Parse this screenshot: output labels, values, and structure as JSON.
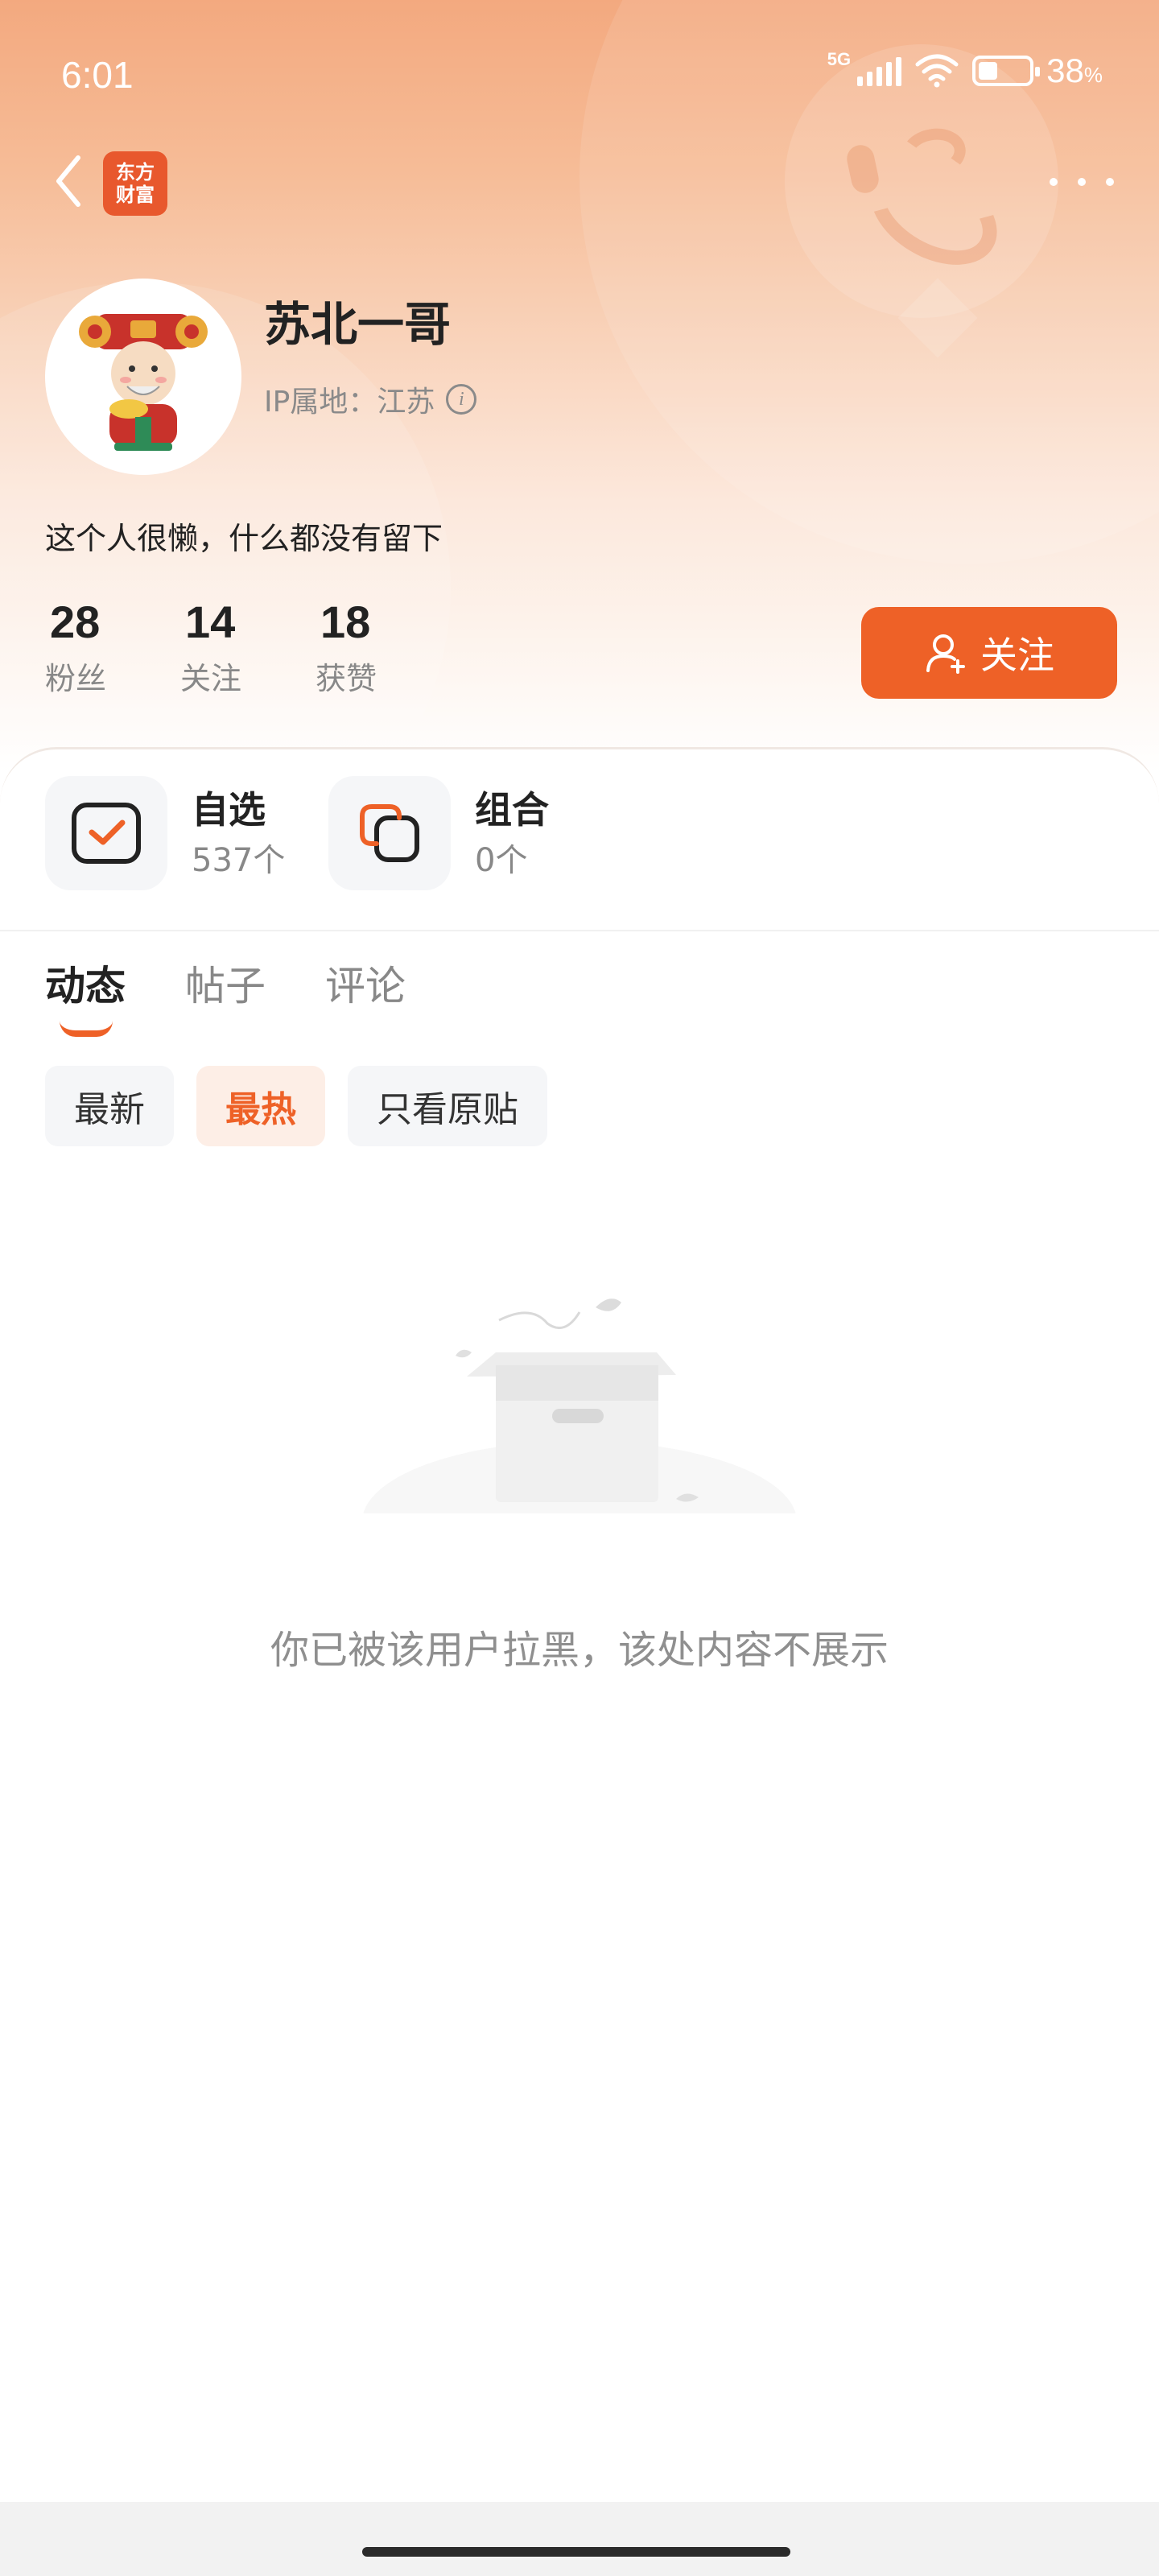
{
  "status_bar": {
    "time": "6:01",
    "network": "5G",
    "battery_percent": "38",
    "battery_unit": "%",
    "battery_level": 0.38
  },
  "nav": {
    "logo_line1": "东方",
    "logo_line2": "财富"
  },
  "profile": {
    "username": "苏北一哥",
    "ip_label": "IP属地：江苏",
    "bio": "这个人很懒，什么都没有留下",
    "stats": [
      {
        "value": "28",
        "label": "粉丝"
      },
      {
        "value": "14",
        "label": "关注"
      },
      {
        "value": "18",
        "label": "获赞"
      }
    ],
    "follow_label": "关注"
  },
  "quick_links": [
    {
      "title": "自选",
      "subtitle": "537个"
    },
    {
      "title": "组合",
      "subtitle": "0个"
    }
  ],
  "tabs": [
    {
      "label": "动态",
      "active": true
    },
    {
      "label": "帖子",
      "active": false
    },
    {
      "label": "评论",
      "active": false
    }
  ],
  "filters": [
    {
      "label": "最新",
      "active": false
    },
    {
      "label": "最热",
      "active": true
    },
    {
      "label": "只看原贴",
      "active": false
    }
  ],
  "empty_state": {
    "message": "你已被该用户拉黑，该处内容不展示"
  },
  "colors": {
    "accent": "#ee6127",
    "brand": "#e8582d"
  }
}
